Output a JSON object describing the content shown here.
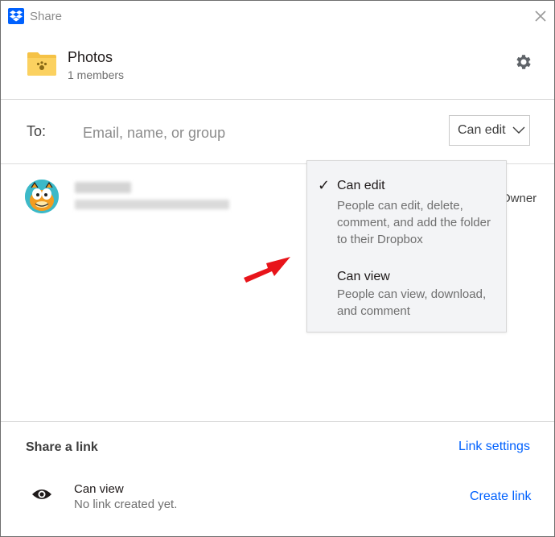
{
  "window": {
    "title": "Share",
    "close_icon": "close-icon",
    "logo_icon": "dropbox-logo-icon",
    "accent_color": "#0061fe"
  },
  "folder": {
    "name": "Photos",
    "members": "1 members",
    "icon": "folder-icon",
    "settings_icon": "gear-icon"
  },
  "invite": {
    "to_label": "To:",
    "placeholder": "Email, name, or group",
    "value": "",
    "permission": "Can edit"
  },
  "member": {
    "role": "Owner",
    "avatar_icon": "avatar-icon"
  },
  "permission_menu": {
    "options": [
      {
        "title": "Can edit",
        "description": "People can edit, delete, comment, and add the folder to their Dropbox",
        "selected": true
      },
      {
        "title": "Can view",
        "description": "People can view, download, and comment",
        "selected": false
      }
    ],
    "check_mark": "✓"
  },
  "share_link": {
    "title": "Share a link",
    "settings_label": "Link settings",
    "permission": "Can view",
    "status": "No link created yet.",
    "create_label": "Create link",
    "eye_icon": "eye-icon"
  },
  "annotation": {
    "arrow_color": "#e8141a"
  }
}
